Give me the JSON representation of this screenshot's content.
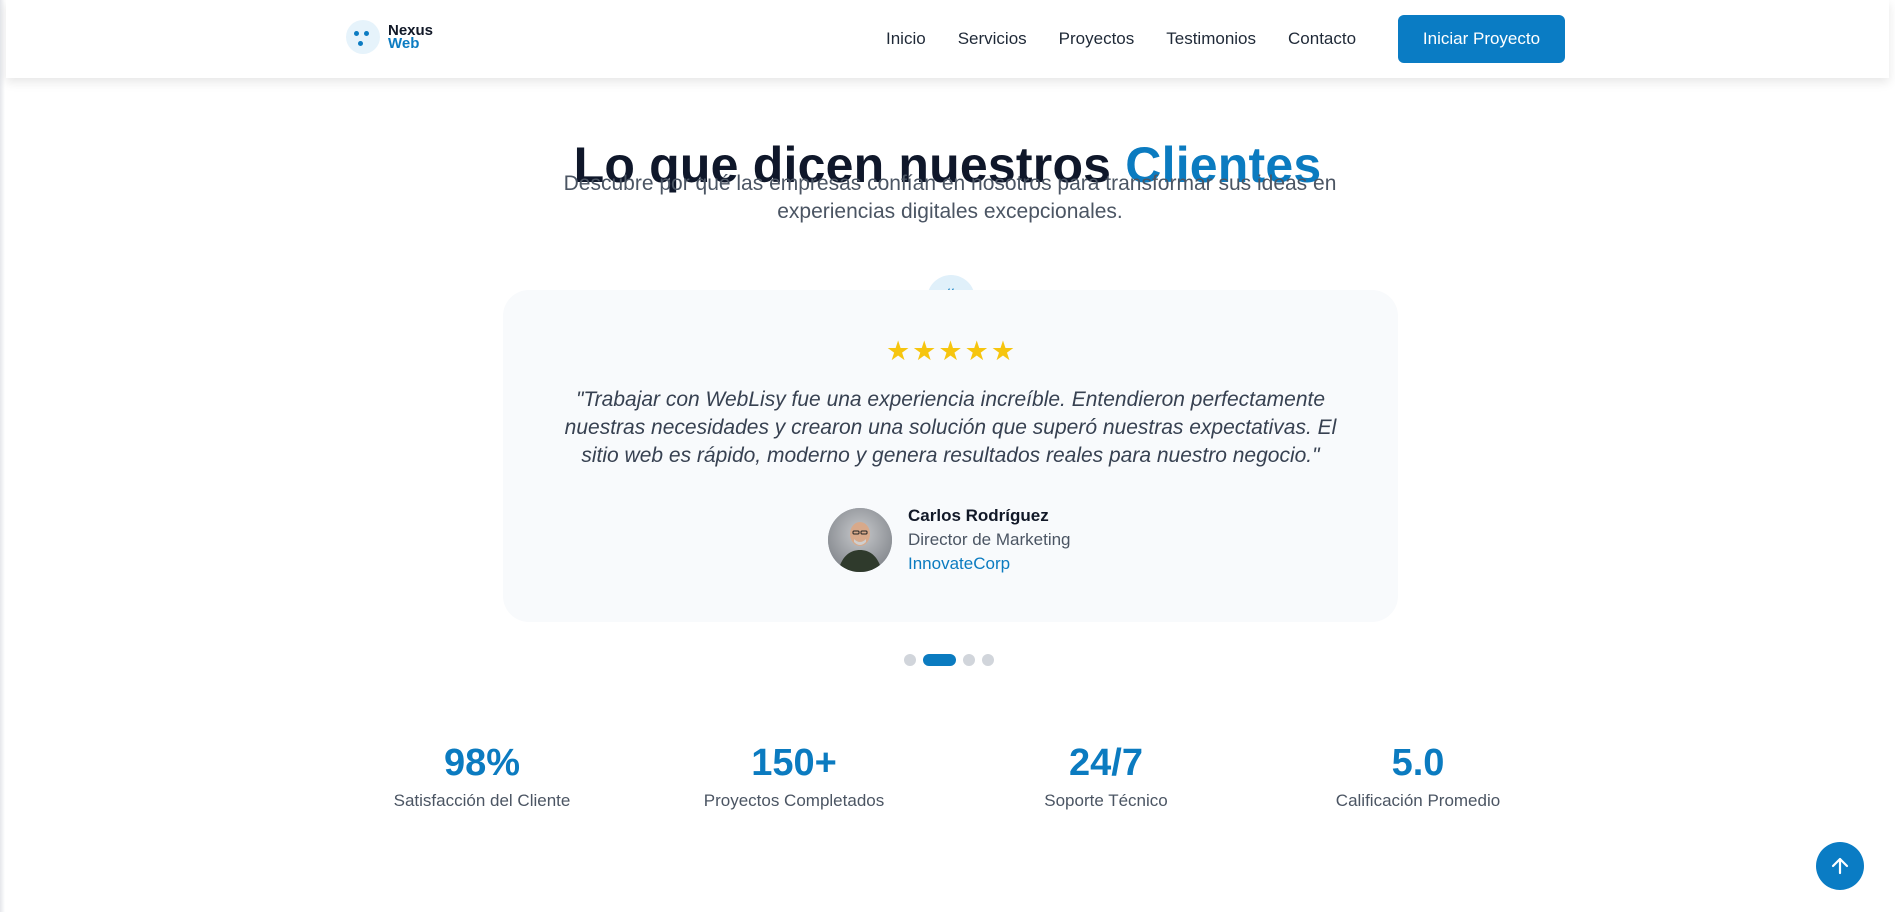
{
  "nav": {
    "brand_line1": "Nexus",
    "brand_line2": "Web",
    "links": [
      "Inicio",
      "Servicios",
      "Proyectos",
      "Testimonios",
      "Contacto"
    ],
    "cta": "Iniciar Proyecto"
  },
  "section": {
    "title_main": "Lo que dicen nuestros ",
    "title_accent": "Clientes",
    "subtitle": "Descubre por qué las empresas confían en nosotros para transformar sus ideas en experiencias digitales excepcionales."
  },
  "testimonial": {
    "rating": 5,
    "quote": "\"Trabajar con WebLisy fue una experiencia increíble. Entendieron perfectamente nuestras necesidades y crearon una solución que superó nuestras expectativas. El sitio web es rápido, moderno y genera resultados reales para nuestro negocio.\"",
    "author_name": "Carlos Rodríguez",
    "author_role": "Director de Marketing",
    "author_company": "InnovateCorp",
    "carousel_total": 4,
    "carousel_active": 2
  },
  "stats": [
    {
      "value": "98%",
      "label": "Satisfacción del Cliente"
    },
    {
      "value": "150+",
      "label": "Proyectos Completados"
    },
    {
      "value": "24/7",
      "label": "Soporte Técnico"
    },
    {
      "value": "5.0",
      "label": "Calificación Promedio"
    }
  ],
  "colors": {
    "accent": "#0b7bc0",
    "star": "#f6c50f",
    "card_bg": "#f8fafc"
  },
  "icons": {
    "quote_badge": "quote-icon",
    "scroll_top": "arrow-up-icon"
  }
}
